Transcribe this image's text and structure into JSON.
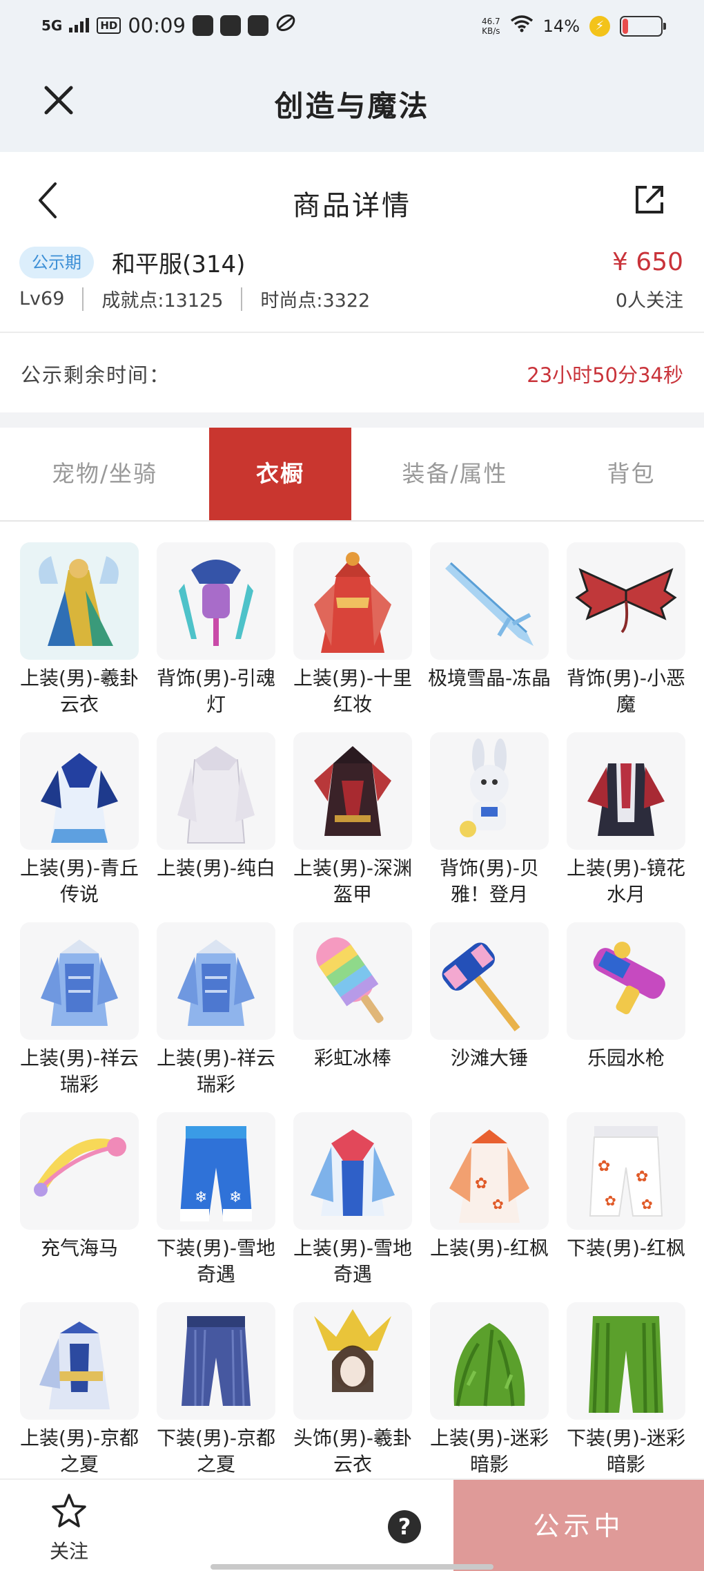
{
  "statusbar": {
    "network": "5G",
    "hd": "HD",
    "time": "00:09",
    "speed_value": "46.7",
    "speed_unit": "KB/s",
    "battery": "14%",
    "battery_level": 0.14
  },
  "titlebar": {
    "title": "创造与魔法"
  },
  "detail": {
    "title": "商品详情"
  },
  "seller": {
    "badge": "公示期",
    "name": "和平服(314)",
    "price": "¥ 650",
    "level": "Lv69",
    "achievement": "成就点:13125",
    "fashion": "时尚点:3322",
    "followers": "0人关注"
  },
  "timer": {
    "label": "公示剩余时间：",
    "value": "23小时50分34秒"
  },
  "tabs": [
    {
      "label": "宠物/坐骑",
      "active": false
    },
    {
      "label": "衣橱",
      "active": true
    },
    {
      "label": "装备/属性",
      "active": false
    },
    {
      "label": "背包",
      "active": false
    }
  ],
  "items": [
    {
      "name": "上装(男)-羲卦云衣",
      "icon": "robe-gold-blue"
    },
    {
      "name": "背饰(男)-引魂灯",
      "icon": "lantern-back"
    },
    {
      "name": "上装(男)-十里红妆",
      "icon": "robe-red"
    },
    {
      "name": "极境雪晶-冻晶",
      "icon": "ice-sword"
    },
    {
      "name": "背饰(男)-小恶魔",
      "icon": "demon-wings"
    },
    {
      "name": "上装(男)-青丘传说",
      "icon": "robe-blue-white"
    },
    {
      "name": "上装(男)-纯白",
      "icon": "coat-white"
    },
    {
      "name": "上装(男)-深渊盔甲",
      "icon": "armor-dark-red"
    },
    {
      "name": "背饰(男)-贝雅！登月",
      "icon": "bunny-astronaut"
    },
    {
      "name": "上装(男)-镜花水月",
      "icon": "robe-dark-red"
    },
    {
      "name": "上装(男)-祥云瑞彩",
      "icon": "armor-light-blue"
    },
    {
      "name": "上装(男)-祥云瑞彩",
      "icon": "armor-light-blue"
    },
    {
      "name": "彩虹冰棒",
      "icon": "rainbow-popsicle"
    },
    {
      "name": "沙滩大锤",
      "icon": "beach-hammer"
    },
    {
      "name": "乐园水枪",
      "icon": "water-gun"
    },
    {
      "name": "充气海马",
      "icon": "inflatable-seahorse"
    },
    {
      "name": "下装(男)-雪地奇遇",
      "icon": "pants-blue-snow"
    },
    {
      "name": "上装(男)-雪地奇遇",
      "icon": "jacket-blue-snow"
    },
    {
      "name": "上装(男)-红枫",
      "icon": "robe-maple"
    },
    {
      "name": "下装(男)-红枫",
      "icon": "pants-maple"
    },
    {
      "name": "上装(男)-京都之夏",
      "icon": "robe-kyoto"
    },
    {
      "name": "下装(男)-京都之夏",
      "icon": "pants-kyoto"
    },
    {
      "name": "头饰(男)-羲卦云衣",
      "icon": "headdress-gold"
    },
    {
      "name": "上装(男)-迷彩暗影",
      "icon": "ghillie-top"
    },
    {
      "name": "下装(男)-迷彩暗影",
      "icon": "ghillie-pants"
    }
  ],
  "bottom": {
    "follow": "关注",
    "help": "?",
    "status": "公示中"
  }
}
